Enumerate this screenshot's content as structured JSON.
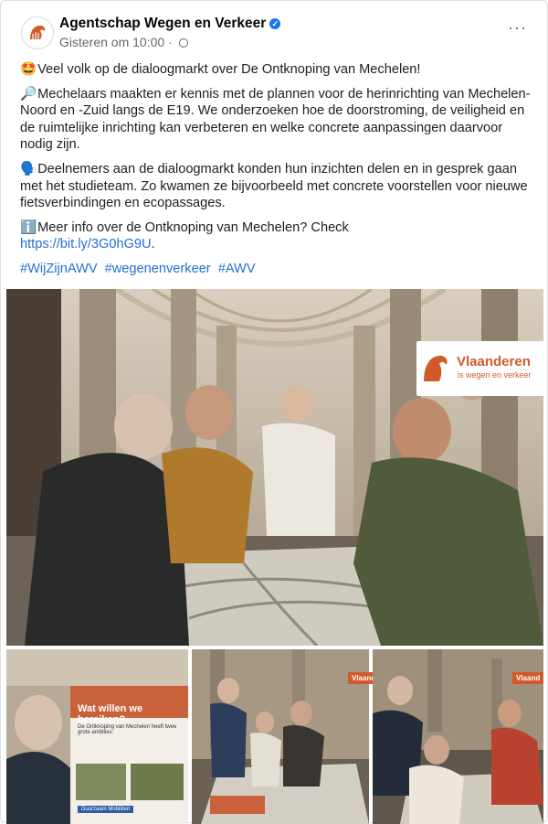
{
  "post": {
    "page_name": "Agentschap Wegen en Verkeer",
    "verified_icon": "verified-checkmark-icon",
    "timestamp": "Gisteren om 10:00",
    "separator": "·",
    "more_icon": "more-horizontal-icon",
    "more_label": "···"
  },
  "content": {
    "line1_emoji": "🤩",
    "line1": "Veel volk op de dialoogmarkt over De Ontknoping van Mechelen!",
    "para2_emoji": "🔎",
    "para2": "Mechelaars maakten er kennis met de plannen voor de herinrichting van Mechelen-Noord en -Zuid langs de E19. We onderzoeken hoe de doorstroming, de veiligheid en de ruimtelijke inrichting kan verbeteren en welke concrete aanpassingen daarvoor nodig zijn.",
    "para3_emoji": "🗣️",
    "para3": "Deelnemers aan de dialoogmarkt konden hun inzichten delen en in gesprek gaan met het studieteam. Zo kwamen ze bijvoorbeeld met concrete voorstellen voor nieuwe fietsverbindingen en ecopassages.",
    "para4_emoji": "ℹ️",
    "para4": "Meer info over de Ontknoping van Mechelen? Check",
    "link": "https://bit.ly/3G0hG9U",
    "link_suffix": ".",
    "hashtags": [
      "#WijZijnAWV",
      "#wegenenverkeer",
      "#AWV"
    ]
  },
  "photos": {
    "badge_title": "Vlaanderen",
    "badge_subtitle": "is wegen en verkeer",
    "poster_title": "Wat willen we bereiken?",
    "poster_text": "De Ontknoping van Mechelen heeft twee grote ambities:",
    "poster_button": "Duurzaam Mobiliteit",
    "mini_badge": "Vlaand"
  },
  "colors": {
    "link": "#216fdb",
    "verified": "#1877f2",
    "brand_orange": "#d15a2a",
    "meta_gray": "#65676b"
  }
}
